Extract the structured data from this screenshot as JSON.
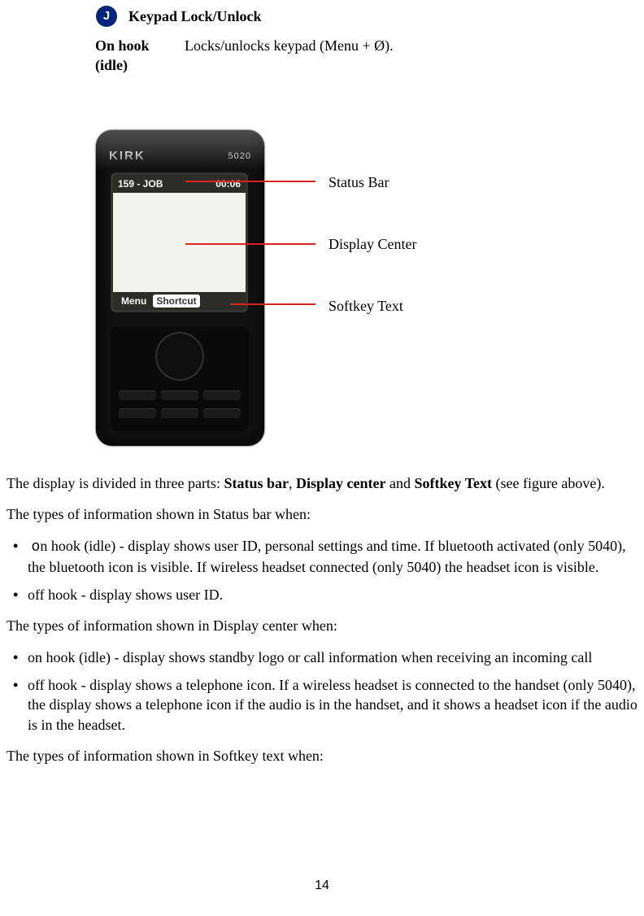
{
  "section": {
    "marker": "J",
    "title": "Keypad Lock/Unlock",
    "term": "On hook (idle)",
    "desc": "Locks/unlocks keypad (Menu + Ø)."
  },
  "phone": {
    "brand": "KIRK",
    "model": "5020",
    "status_left": "159 - JOB",
    "status_right": "00:06",
    "softkey_left": "Menu",
    "softkey_right": "Shortcut"
  },
  "callouts": {
    "status": "Status Bar",
    "center": "Display Center",
    "softkey": "Softkey Text"
  },
  "body": {
    "p1_a": "The display is divided in three parts: ",
    "p1_b": "Status bar",
    "p1_c": ", ",
    "p1_d": "Display center",
    "p1_e": " and ",
    "p1_f": "Softkey Text",
    "p1_g": " (see figure above).",
    "p2": "The types of information shown in Status bar when:",
    "li1_first": "o",
    "li1_rest": "n hook (idle) - display shows user ID, personal settings and time. If bluetooth activated (only 5040), the bluetooth icon is visible. If wireless headset connected (only 5040) the headset icon is visible.",
    "li2": "off hook - display shows user ID.",
    "p3": "The types of information shown in Display center when:",
    "li3": "on hook (idle) - display shows standby logo or call information when receiving an incoming call",
    "li4": "off hook - display shows a telephone icon. If a wireless headset is connected to the handset (only 5040), the display shows a telephone icon if the audio is in the handset, and it shows a headset icon if the audio is in the headset.",
    "p4": "The types of information shown in Softkey text when:"
  },
  "page_number": "14"
}
